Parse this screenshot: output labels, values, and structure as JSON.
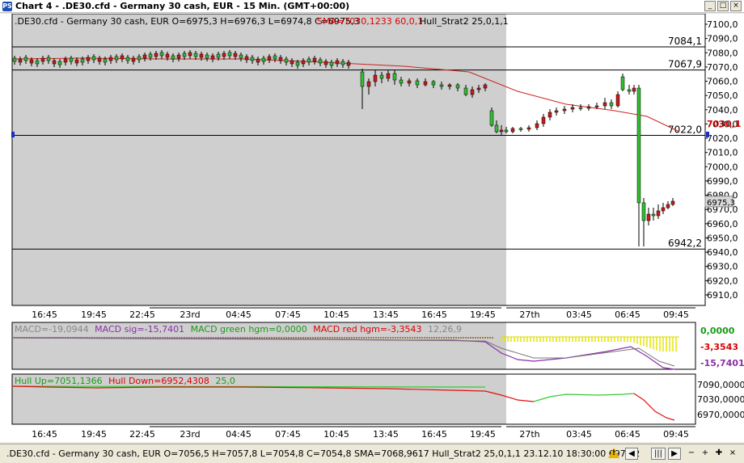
{
  "window": {
    "title": "Chart 4 - .DE30.cfd - Germany 30 cash, EUR - 15 Min. (GMT+00:00)",
    "icon_label": "PS",
    "controls": [
      "minimize",
      "maximize",
      "close"
    ]
  },
  "main_chart": {
    "info_line": ".DE30.cfd - Germany 30 cash, EUR O=6975,3 H=6976,3 L=6974,8 C=6975,3",
    "sma_label": "SMA=7030,1233  60,0,1",
    "hull_label": "Hull_Strat2  25,0,1,1",
    "y_ticks": [
      "7100,0",
      "7090,0",
      "7080,0",
      "7070,0",
      "7060,0",
      "7050,0",
      "7040,0",
      "7030,0",
      "7020,0",
      "7010,0",
      "7000,0",
      "6990,0",
      "6980,0",
      "6970,0",
      "6960,0",
      "6950,0",
      "6940,0",
      "6930,0",
      "6920,0",
      "6910,0"
    ],
    "levels": [
      {
        "label": "7084,1",
        "value": 7084.1
      },
      {
        "label": "7067,9",
        "value": 7067.9
      },
      {
        "label": "7022,0",
        "value": 7022.0
      },
      {
        "label": "6942,2",
        "value": 6942.2
      }
    ],
    "sma_price_label": "7030,1",
    "sma_value": 7030.1,
    "current_price_label": "6975,3",
    "current_price": 6975.3,
    "x_labels": [
      "16:45",
      "19:45",
      "22:45",
      "23rd",
      "04:45",
      "07:45",
      "10:45",
      "13:45",
      "16:45",
      "19:45",
      "27th",
      "03:45",
      "06:45",
      "09:45"
    ]
  },
  "macd_panel": {
    "label_macd": "MACD=-19,0944",
    "label_sig": "MACD sig=-15,7401",
    "label_green": "MACD green hgm=0,0000",
    "label_red": "MACD red hgm=-3,3543",
    "label_params": "12,26,9",
    "right_values": [
      "0,0000",
      "-3,3543",
      "-15,7401"
    ]
  },
  "hull_panel": {
    "label_up": "Hull Up=7051,1366",
    "label_down": "Hull Down=6952,4308",
    "label_params": "25,0",
    "y_ticks": [
      "7090,0000",
      "7030,0000",
      "6970,0000"
    ]
  },
  "bottom_x_labels": [
    "16:45",
    "19:45",
    "22:45",
    "23rd",
    "04:45",
    "07:45",
    "10:45",
    "13:45",
    "16:45",
    "19:45",
    "27th",
    "03:45",
    "06:45",
    "09:45"
  ],
  "status_bar": {
    "text": ".DE30.cfd - Germany 30 cash, EUR O=7056,5 H=7057,8 L=7054,8 C=7054,8  SMA=7068,9617 Hull_Strat2  25,0,1,1  23.12.10 18:30:00 6979,2",
    "buttons": [
      "scroll-left",
      "scroll-handle",
      "scroll-right",
      "zoom-out",
      "zoom-in",
      "crosshair",
      "close"
    ]
  },
  "colors": {
    "history_bg": "#cfcfcf",
    "bull_candle": "#2fbf2f",
    "bear_candle": "#cc1a1a",
    "sma_line": "#cc2222",
    "hull_up": "#33cc33",
    "hull_down": "#dd1111",
    "macd_purple": "#8b2fa8",
    "macd_yellow": "#e6e600"
  }
}
